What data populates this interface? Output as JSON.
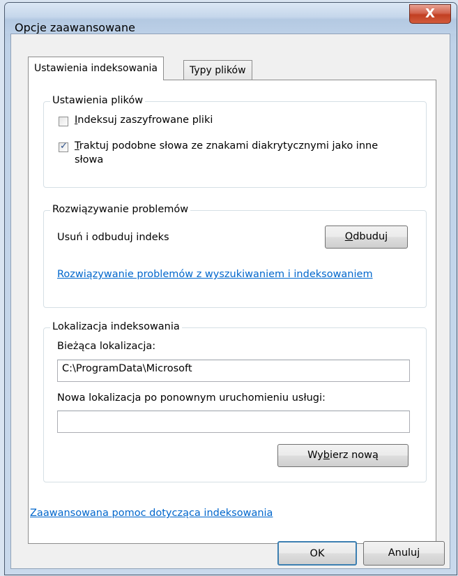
{
  "window": {
    "title": "Opcje zaawansowane",
    "close_glyph": "X"
  },
  "tabs": [
    {
      "label": "Ustawienia indeksowania",
      "active": true
    },
    {
      "label": "Typy plików",
      "active": false
    }
  ],
  "file_settings": {
    "group_label": "Ustawienia plików",
    "encrypted": {
      "label_first": "I",
      "label_rest": "ndeksuj zaszyfrowane pliki",
      "checked": false
    },
    "diacritics": {
      "label_first": "T",
      "label_rest": "raktuj podobne słowa ze znakami diakrytycznymi jako inne",
      "label_line2": "słowa",
      "checked": true,
      "check_glyph": "✓"
    }
  },
  "troubleshooting": {
    "group_label": "Rozwiązywanie problemów",
    "rebuild_text": "Usuń i odbuduj indeks",
    "rebuild_button_first": "O",
    "rebuild_button_rest": "dbuduj",
    "help_link": "Rozwiązywanie problemów z wyszukiwaniem i indeksowaniem"
  },
  "location": {
    "group_label": "Lokalizacja indeksowania",
    "current_label": "Bieżąca lokalizacja:",
    "current_value": "C:\\ProgramData\\Microsoft",
    "new_label": "Nowa lokalizacja po ponownym uruchomieniu usługi:",
    "new_value": "",
    "choose_button_pre": "Wy",
    "choose_button_u": "b",
    "choose_button_post": "ierz nową"
  },
  "footer": {
    "advanced_link": "Zaawansowana pomoc dotycząca indeksowania",
    "ok_label": "OK",
    "cancel_label": "Anuluj"
  }
}
